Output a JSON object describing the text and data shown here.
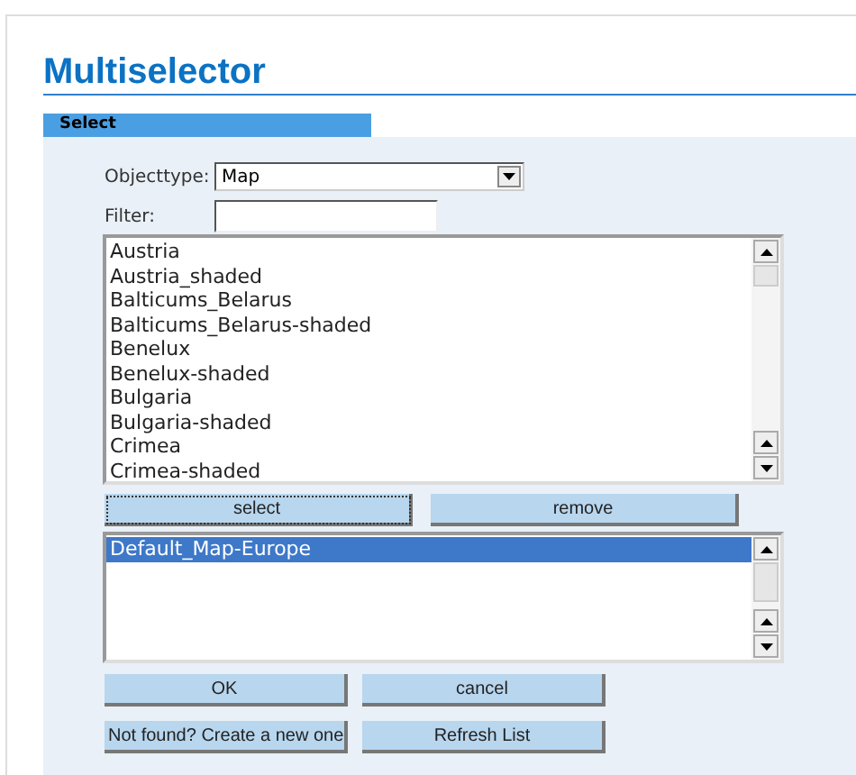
{
  "title": "Multiselector",
  "tabs": [
    {
      "label": "Select",
      "selected": true
    }
  ],
  "objecttype": {
    "label": "Objecttype:",
    "value": "Map"
  },
  "filter": {
    "label": "Filter:"
  },
  "available": [
    {
      "label": "Austria",
      "selected": false
    },
    {
      "label": "Austria_shaded",
      "selected": false
    },
    {
      "label": "Balticums_Belarus",
      "selected": false
    },
    {
      "label": "Balticums_Belarus-shaded",
      "selected": false
    },
    {
      "label": "Benelux",
      "selected": false
    },
    {
      "label": "Benelux-shaded",
      "selected": false
    },
    {
      "label": "Bulgaria",
      "selected": false
    },
    {
      "label": "Bulgaria-shaded",
      "selected": false
    },
    {
      "label": "Crimea",
      "selected": false
    },
    {
      "label": "Crimea-shaded",
      "selected": false
    }
  ],
  "move_buttons": [
    "select",
    "remove"
  ],
  "chosen": [
    {
      "label": "Default_Map-Europe",
      "selected": true
    }
  ],
  "buttons": [
    "OK",
    "cancel",
    "Not found? Create a new one",
    "Refresh List"
  ]
}
